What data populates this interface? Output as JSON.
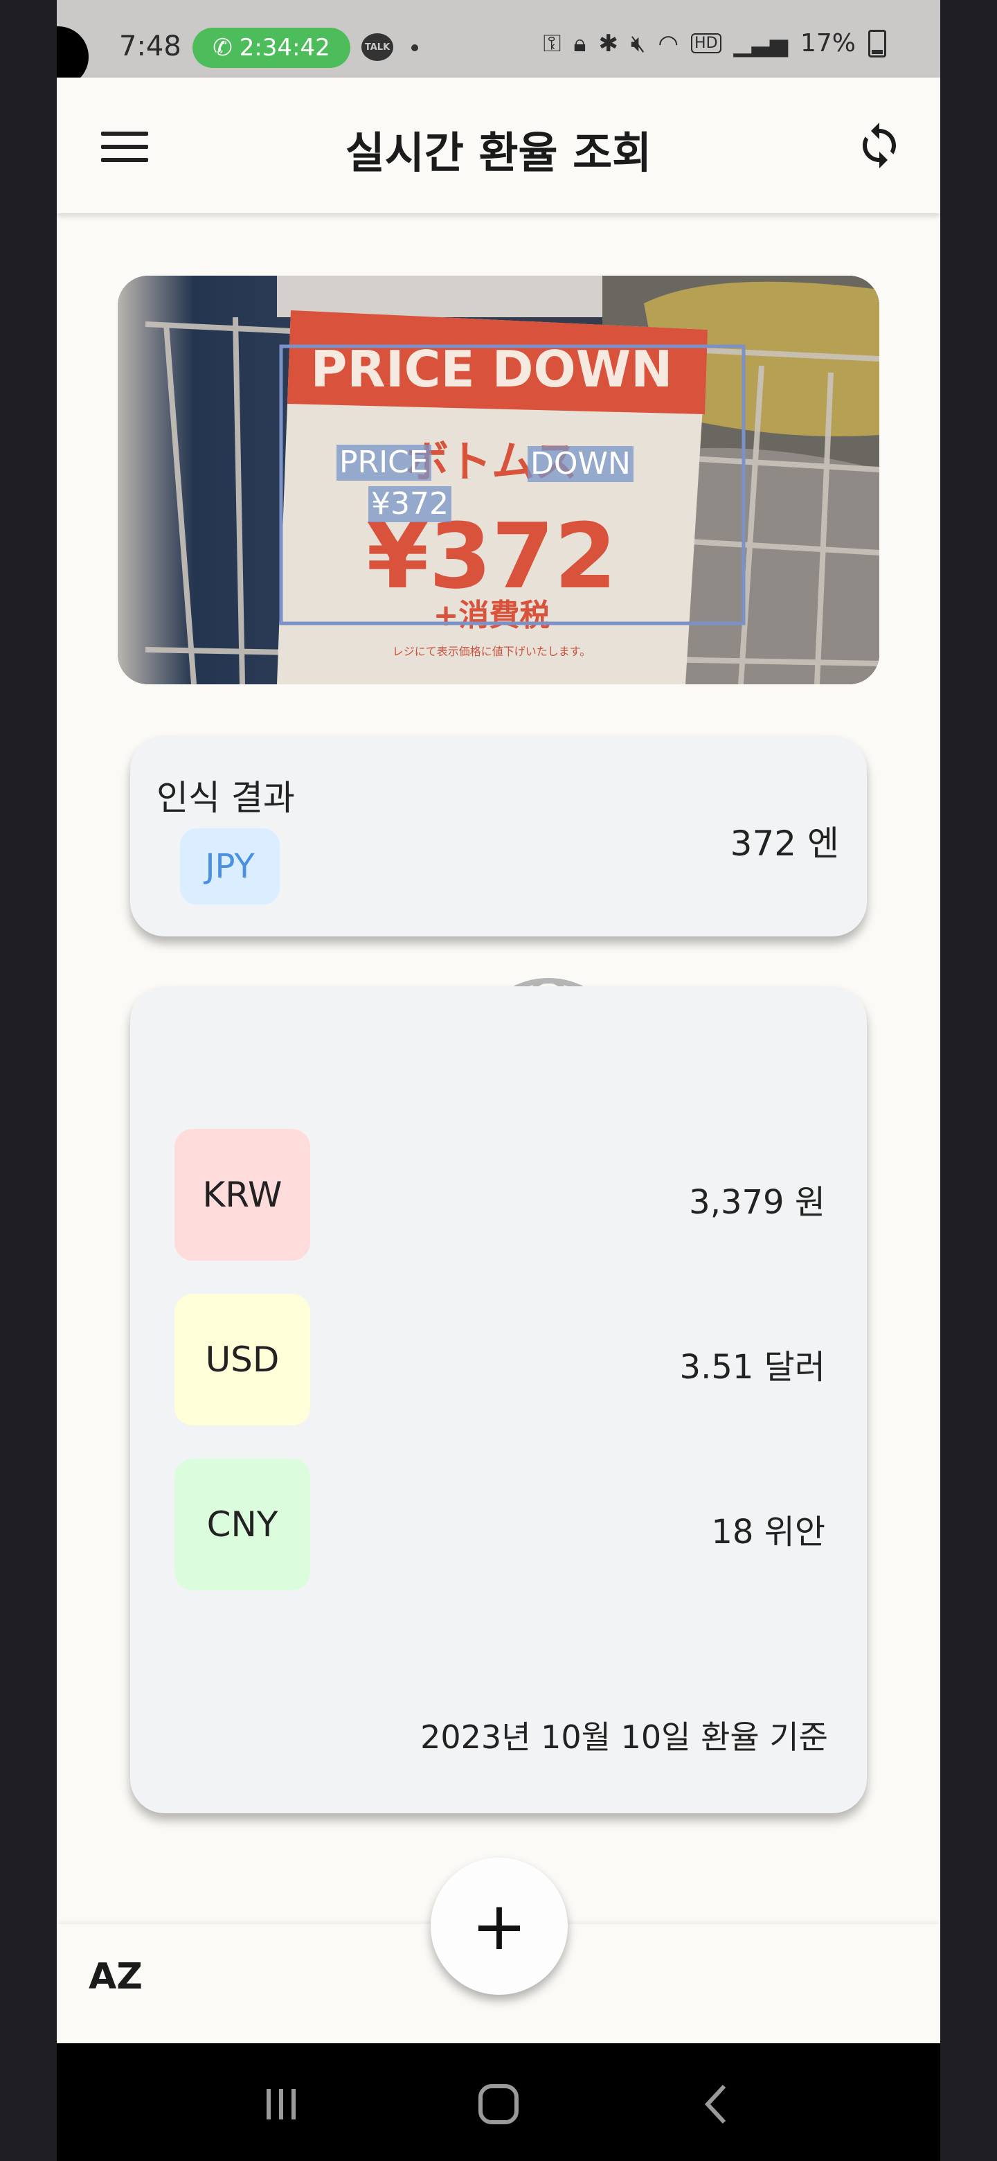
{
  "status_bar": {
    "time": "7:48",
    "call_timer": "2:34:42",
    "talk_badge": "TALK",
    "battery_percent": "17%",
    "hd_badge": "HD"
  },
  "app_bar": {
    "title": "실시간 환율 조회",
    "menu_icon": "hamburger-menu-icon",
    "refresh_icon": "refresh-icon"
  },
  "photo": {
    "sign_heading": "PRICE DOWN",
    "sign_line": "ボトムス",
    "sign_price": "¥372",
    "sign_tax": "+消費税",
    "sign_note": "レジにて表示価格に値下げいたします。",
    "ocr_labels": {
      "price": "PRICE",
      "down": "DOWN",
      "yen": "¥372"
    }
  },
  "recognition": {
    "title": "인식 결과",
    "currency": "JPY",
    "value": "372 엔"
  },
  "conversions": [
    {
      "code": "KRW",
      "value": "3,379 원",
      "color": "#ffdcdc"
    },
    {
      "code": "USD",
      "value": "3.51 달러",
      "color": "#fefed9"
    },
    {
      "code": "CNY",
      "value": "18 위안",
      "color": "#dcfddd"
    }
  ],
  "rate_date": "2023년 10월 10일 환율 기준",
  "bottom_bar": {
    "sort_label": "AZ",
    "fab_label": "+"
  },
  "colors": {
    "call_green": "#4cbd5a",
    "jpy_chip_bg": "#dbeeff",
    "jpy_chip_text": "#4a90e2",
    "card_bg": "#f2f3f4",
    "screen_bg": "#fbfaf6"
  }
}
